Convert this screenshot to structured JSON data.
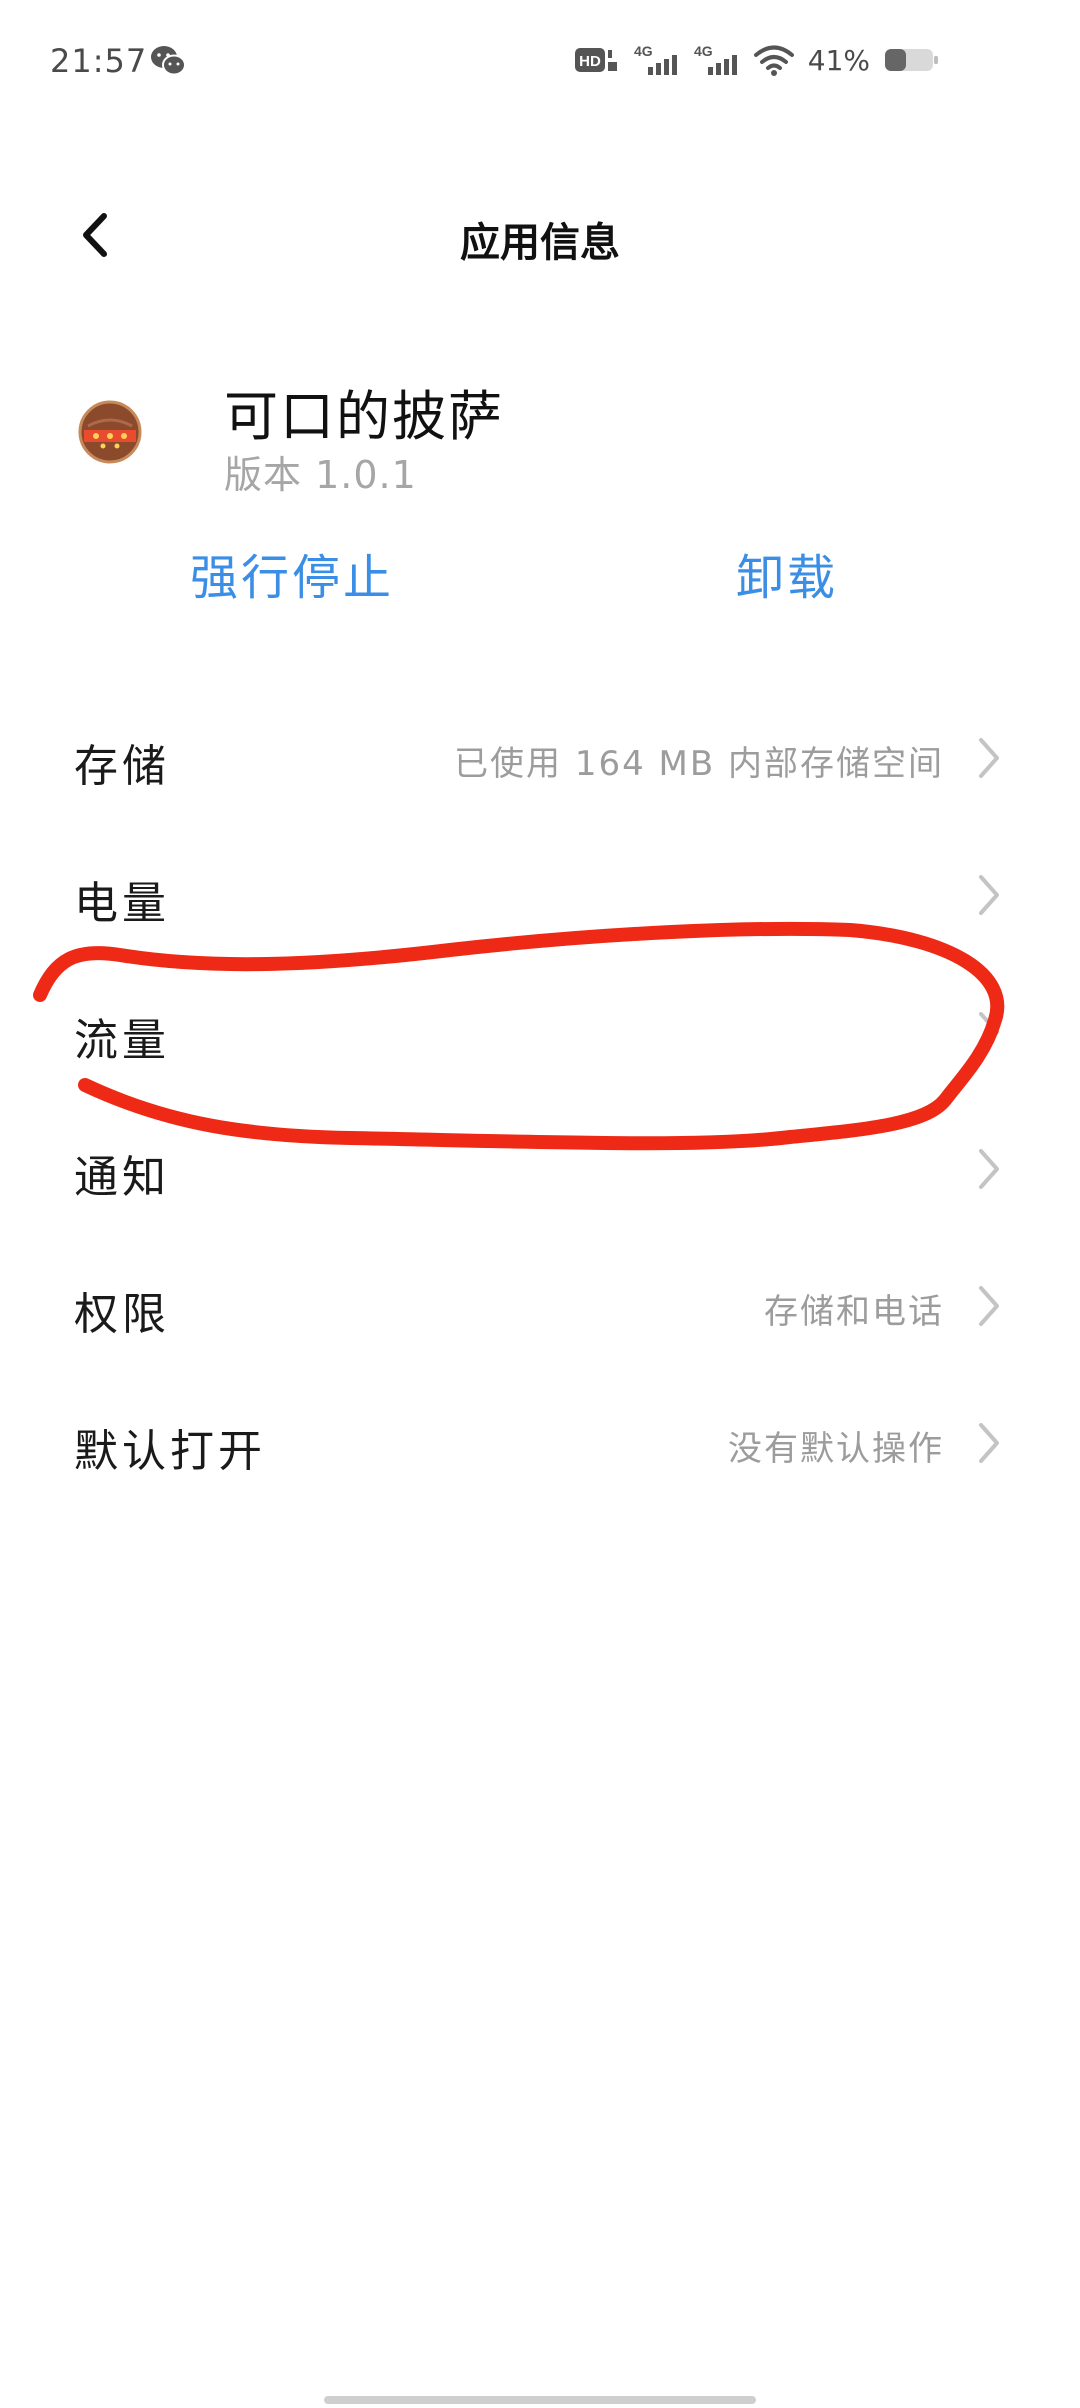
{
  "status_bar": {
    "time": "21:57",
    "notification_icon": "wechat-icon",
    "battery_percent": "41%",
    "network_labels": [
      "HD",
      "4G",
      "4G"
    ]
  },
  "header": {
    "back_icon": "chevron-left-icon",
    "title": "应用信息"
  },
  "app": {
    "name": "可口的披萨",
    "version": "版本 1.0.1",
    "icon": "pizza-icon"
  },
  "actions": {
    "force_stop": "强行停止",
    "uninstall": "卸载"
  },
  "settings": [
    {
      "label": "存储",
      "value": "已使用 164 MB 内部存储空间"
    },
    {
      "label": "电量",
      "value": ""
    },
    {
      "label": "流量",
      "value": ""
    },
    {
      "label": "通知",
      "value": ""
    },
    {
      "label": "权限",
      "value": "存储和电话"
    },
    {
      "label": "默认打开",
      "value": "没有默认操作"
    }
  ],
  "colors": {
    "accent": "#3a8ee6",
    "annotation_stroke": "#ee2a16",
    "secondary_text": "#9c9c9c"
  }
}
